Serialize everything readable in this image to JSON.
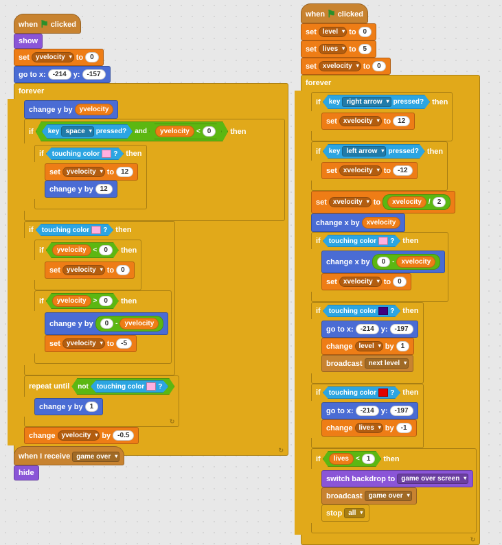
{
  "colors": {
    "pink": "#ffb0e0",
    "purple": "#40007f",
    "red": "#e00000"
  },
  "script1": {
    "hat": "when ⚑ clicked",
    "show": "show",
    "set_yv": {
      "label_set": "set",
      "var": "yvelocity",
      "label_to": "to",
      "val": "0"
    },
    "goto": {
      "label": "go to x:",
      "x": "-214",
      "ylabel": "y:",
      "y": "-157"
    },
    "forever": "forever",
    "change_y_yv": {
      "label": "change y by",
      "var": "yvelocity"
    },
    "if_key_and": {
      "if": "if",
      "key_label": "key",
      "key": "space",
      "pressed": "pressed?",
      "and": "and",
      "var": "yvelocity",
      "op": "<",
      "val": "0",
      "then": "then"
    },
    "if_touch_pink": {
      "if": "if",
      "touch": "touching color",
      "q": "?",
      "then": "then"
    },
    "set_yv12": {
      "label_set": "set",
      "var": "yvelocity",
      "label_to": "to",
      "val": "12"
    },
    "change_y12": {
      "label": "change y by",
      "val": "12"
    },
    "if_touch_pink2": {
      "if": "if",
      "touch": "touching color",
      "q": "?",
      "then": "then"
    },
    "if_yv_lt0": {
      "if": "if",
      "var": "yvelocity",
      "op": "<",
      "val": "0",
      "then": "then"
    },
    "set_yv0": {
      "label_set": "set",
      "var": "yvelocity",
      "label_to": "to",
      "val": "0"
    },
    "if_yv_gt0": {
      "if": "if",
      "var": "yvelocity",
      "op": ">",
      "val": "0",
      "then": "then"
    },
    "change_y_0minus": {
      "label": "change y by",
      "zero": "0",
      "minus": "-",
      "var": "yvelocity"
    },
    "set_yv_neg5": {
      "label_set": "set",
      "var": "yvelocity",
      "label_to": "to",
      "val": "-5"
    },
    "repeat_until": {
      "label": "repeat until",
      "not": "not",
      "touch": "touching color",
      "q": "?"
    },
    "change_y1": {
      "label": "change y by",
      "val": "1"
    },
    "change_yv_neg05": {
      "label": "change",
      "var": "yvelocity",
      "by": "by",
      "val": "-0.5"
    }
  },
  "script2": {
    "hat": "when I receive",
    "msg": "game over",
    "hide": "hide"
  },
  "script3": {
    "hat": "when ⚑ clicked",
    "set_level": {
      "set": "set",
      "var": "level",
      "to": "to",
      "val": "0"
    },
    "set_lives": {
      "set": "set",
      "var": "lives",
      "to": "to",
      "val": "5"
    },
    "set_xv": {
      "set": "set",
      "var": "xvelocity",
      "to": "to",
      "val": "0"
    },
    "forever": "forever",
    "if_right": {
      "if": "if",
      "key": "key",
      "arrow": "right arrow",
      "pressed": "pressed?",
      "then": "then"
    },
    "set_xv12": {
      "set": "set",
      "var": "xvelocity",
      "to": "to",
      "val": "12"
    },
    "if_left": {
      "if": "if",
      "key": "key",
      "arrow": "left arrow",
      "pressed": "pressed?",
      "then": "then"
    },
    "set_xv_n12": {
      "set": "set",
      "var": "xvelocity",
      "to": "to",
      "val": "-12"
    },
    "set_xv_div": {
      "set": "set",
      "var": "xvelocity",
      "to": "to",
      "var2": "xvelocity",
      "div": "/",
      "val": "2"
    },
    "change_x_xv": {
      "label": "change x by",
      "var": "xvelocity"
    },
    "if_touch_pink": {
      "if": "if",
      "touch": "touching color",
      "q": "?",
      "then": "then"
    },
    "change_x_0minus": {
      "label": "change x by",
      "zero": "0",
      "minus": "-",
      "var": "xvelocity"
    },
    "set_xv0": {
      "set": "set",
      "var": "xvelocity",
      "to": "to",
      "val": "0"
    },
    "if_touch_purple": {
      "if": "if",
      "touch": "touching color",
      "q": "?",
      "then": "then"
    },
    "goto1": {
      "label": "go to x:",
      "x": "-214",
      "ylabel": "y:",
      "y": "-197"
    },
    "change_level": {
      "label": "change",
      "var": "level",
      "by": "by",
      "val": "1"
    },
    "broadcast_next": {
      "label": "broadcast",
      "msg": "next level"
    },
    "if_touch_red": {
      "if": "if",
      "touch": "touching color",
      "q": "?",
      "then": "then"
    },
    "goto2": {
      "label": "go to x:",
      "x": "-214",
      "ylabel": "y:",
      "y": "-197"
    },
    "change_lives": {
      "label": "change",
      "var": "lives",
      "by": "by",
      "val": "-1"
    },
    "if_lives": {
      "if": "if",
      "var": "lives",
      "op": "<",
      "val": "1",
      "then": "then"
    },
    "switch_bd": {
      "label": "switch backdrop to",
      "bd": "game over screen"
    },
    "broadcast_go": {
      "label": "broadcast",
      "msg": "game over"
    },
    "stop": {
      "label": "stop",
      "opt": "all"
    }
  }
}
